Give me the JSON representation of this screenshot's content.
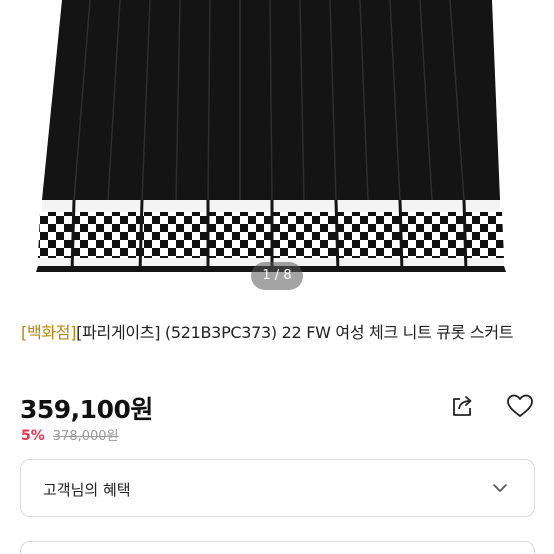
{
  "product": {
    "image_pager": "1 / 8",
    "title_store_tag": "[백화점]",
    "title_text": "[파리게이츠] (521B3PC373) 22 FW 여성 체크 니트 큐롯 스커트",
    "price": "359,100원",
    "discount_rate": "5%",
    "original_price": "378,000원"
  },
  "benefits": {
    "label": "고객님의 혜택"
  },
  "icons": {
    "share": "share-icon",
    "like": "heart-icon",
    "expand": "chevron-down-icon"
  },
  "colors": {
    "store_tag": "#b8860b",
    "discount": "#e8344e"
  }
}
